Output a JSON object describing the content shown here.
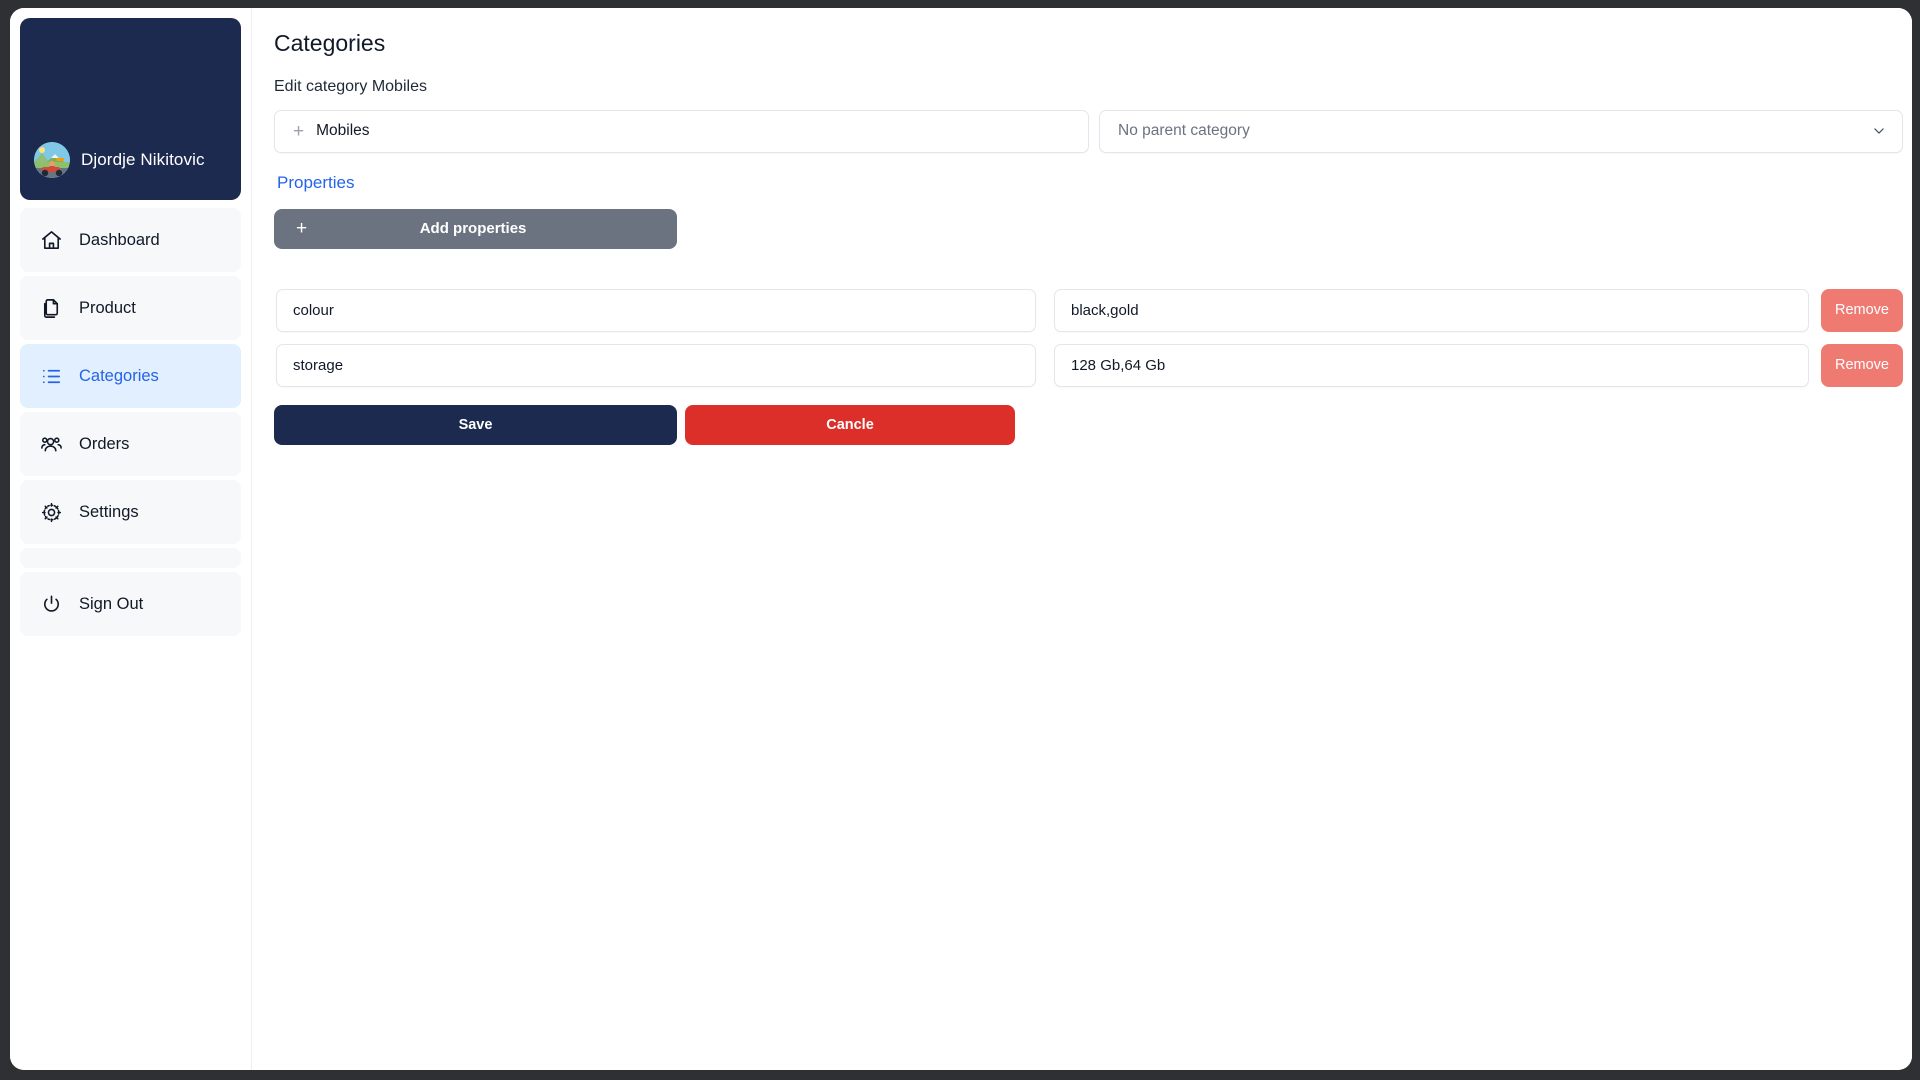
{
  "sidebar": {
    "profile": {
      "name": "Djordje Nikitovic",
      "avatar_icon": "go-kart-avatar"
    },
    "items": [
      {
        "label": "Dashboard",
        "icon": "home-icon",
        "active": false
      },
      {
        "label": "Product",
        "icon": "documents-icon",
        "active": false
      },
      {
        "label": "Categories",
        "icon": "list-icon",
        "active": true
      },
      {
        "label": "Orders",
        "icon": "users-icon",
        "active": false
      },
      {
        "label": "Settings",
        "icon": "gear-icon",
        "active": false
      }
    ],
    "signout": {
      "label": "Sign Out",
      "icon": "power-icon"
    }
  },
  "main": {
    "title": "Categories",
    "subtitle": "Edit category Mobiles",
    "category_name": {
      "value": "Mobiles",
      "icon": "plus-icon"
    },
    "parent_category": {
      "selected": "No parent category",
      "options": [
        "No parent category"
      ],
      "icon": "chevron-down-icon"
    },
    "properties_label": "Properties",
    "add_properties": {
      "label": "Add properties",
      "icon": "plus-icon"
    },
    "properties": [
      {
        "name": "colour",
        "value": "black,gold",
        "remove_label": "Remove"
      },
      {
        "name": "storage",
        "value": "128 Gb,64 Gb",
        "remove_label": "Remove"
      }
    ],
    "save_label": "Save",
    "cancel_label": "Cancle"
  },
  "colors": {
    "brand_navy": "#1b2a4e",
    "accent_blue": "#2563eb",
    "active_bg": "#e1effe",
    "nav_bg": "#f7f8fa",
    "gray_button": "#6b7280",
    "remove_red": "#ef7a72",
    "cancel_red": "#dc2f2a",
    "frame_dark": "#2f3033"
  }
}
